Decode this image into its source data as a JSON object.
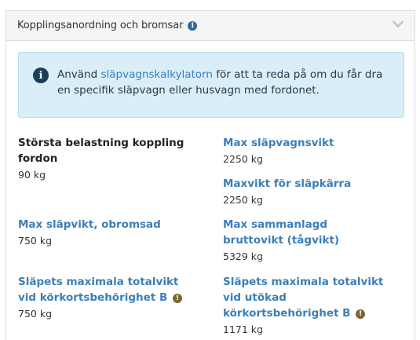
{
  "panel": {
    "title": "Kopplingsanordning och bromsar",
    "title_icon": "info-icon",
    "toggle_icon": "chevron-down-icon"
  },
  "alert": {
    "icon": "info-icon",
    "prefix": "Använd ",
    "link_text": "släpvagnskalkylatorn",
    "suffix": " för att ta reda på om du får dra en specifik släpvagn eller husvagn med fordonet."
  },
  "fields": {
    "coupling_load": {
      "label": "Största belastning koppling fordon",
      "value": "90 kg"
    },
    "max_trailer_weight": {
      "label": "Max släpvagnsvikt",
      "value": "2250 kg"
    },
    "max_weight_cart": {
      "label": "Maxvikt för släpkärra",
      "value": "2250 kg"
    },
    "max_unbraked": {
      "label": "Max släpvikt, obromsad",
      "value": "750 kg"
    },
    "max_combined": {
      "label": "Max sammanlagd bruttovikt (tågvikt)",
      "value": "5329 kg"
    },
    "trailer_b": {
      "label": "Släpets maximala totalvikt vid körkortsbehörighet B",
      "value": "750 kg",
      "icon": "warning-icon"
    },
    "trailer_b_ext": {
      "label": "Släpets maximala totalvikt vid utökad körkortsbehörighet B",
      "value": "1171 kg",
      "icon": "warning-icon"
    }
  },
  "colors": {
    "link": "#3a7fc1",
    "field_label": "#3c7fb8",
    "alert_bg": "#d9eef8",
    "warning": "#7a6734"
  }
}
